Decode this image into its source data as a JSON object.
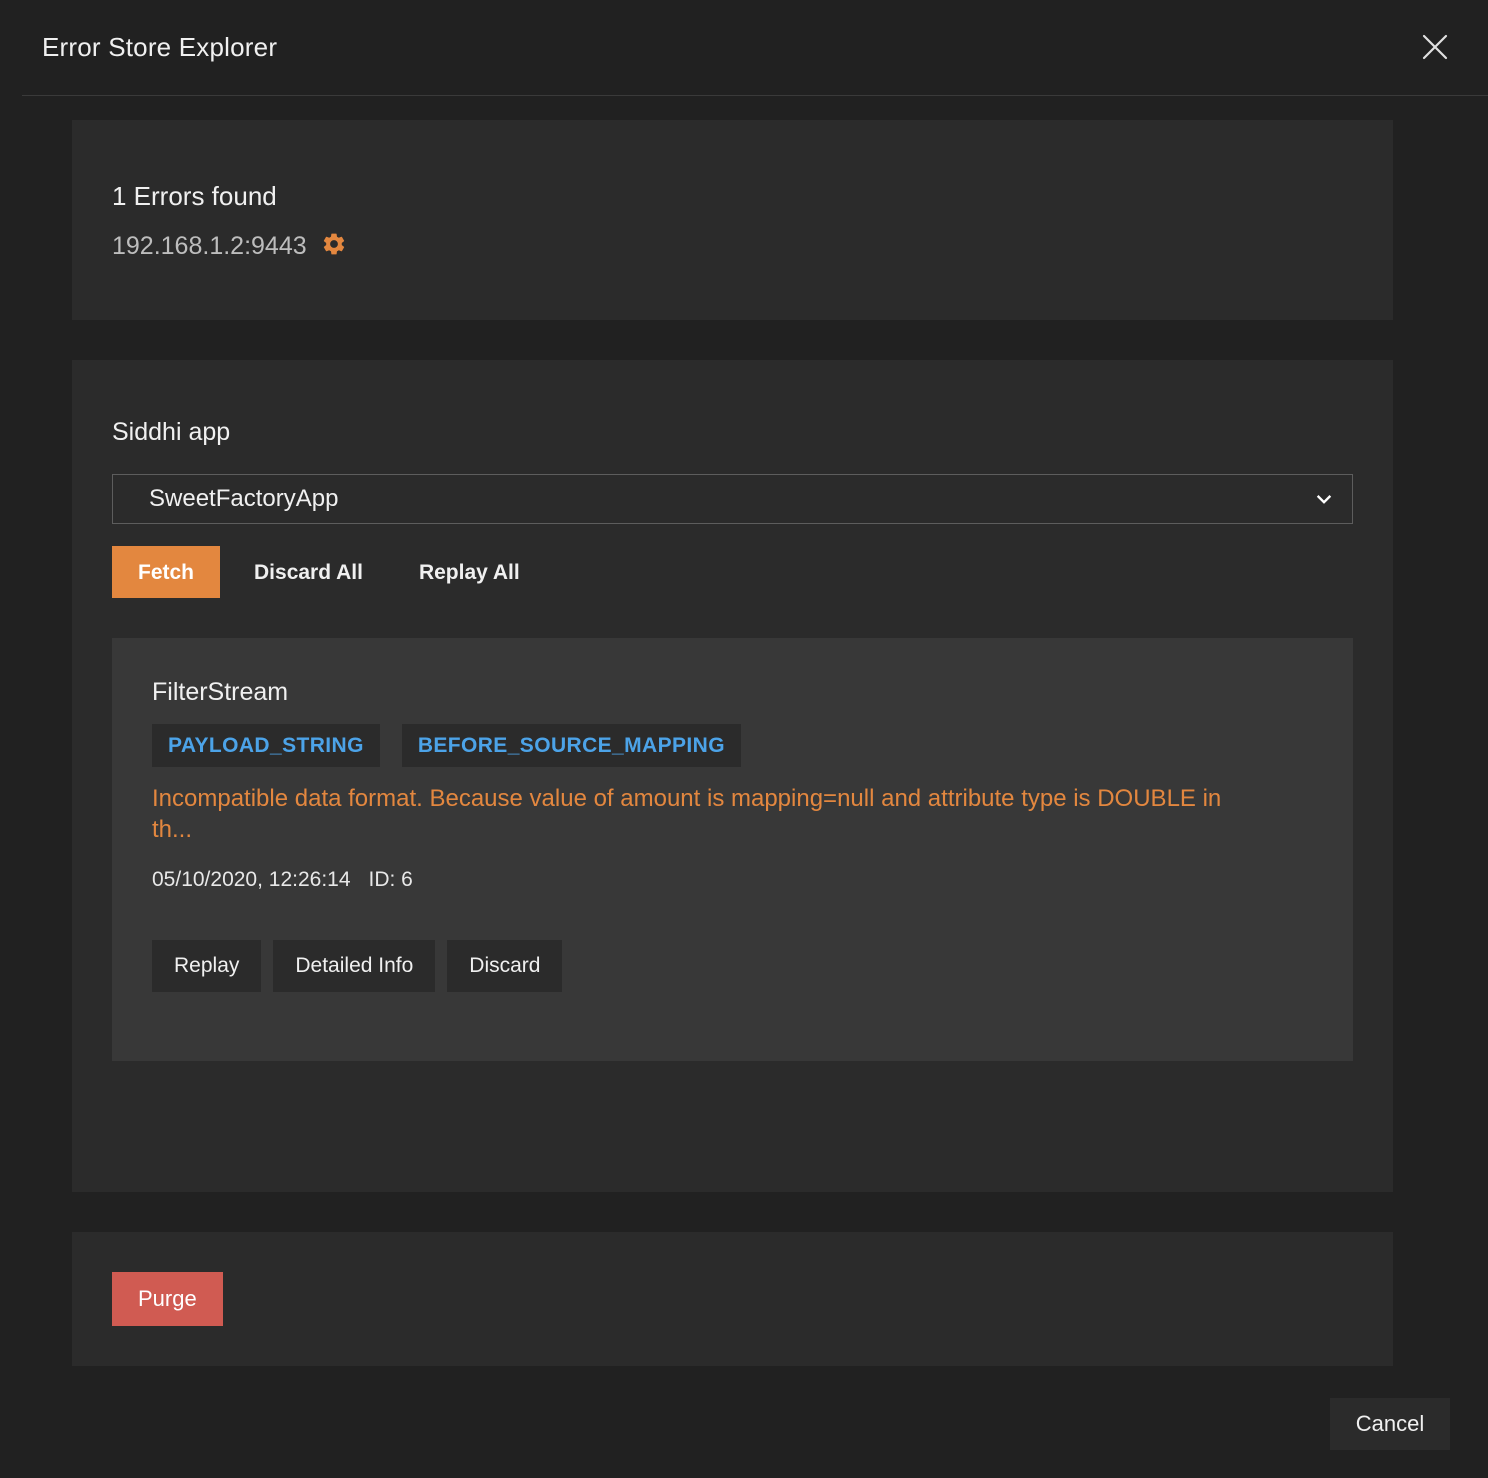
{
  "modal": {
    "title": "Error Store Explorer",
    "close_icon": "close-icon"
  },
  "summary": {
    "errors_found": "1 Errors found",
    "host": "192.168.1.2:9443",
    "settings_icon": "gear-icon"
  },
  "form": {
    "label": "Siddhi app",
    "selected_app": "SweetFactoryApp",
    "dropdown_icon": "chevron-down-icon",
    "actions": {
      "fetch": "Fetch",
      "discard_all": "Discard All",
      "replay_all": "Replay All"
    }
  },
  "error_card": {
    "stream_name": "FilterStream",
    "chips": [
      "PAYLOAD_STRING",
      "BEFORE_SOURCE_MAPPING"
    ],
    "message": "Incompatible data format. Because value of amount is mapping=null and attribute type is DOUBLE in th...",
    "timestamp": "05/10/2020, 12:26:14",
    "id_label": "ID: 6",
    "actions": {
      "replay": "Replay",
      "detailed_info": "Detailed Info",
      "discard": "Discard"
    }
  },
  "purge": {
    "label": "Purge"
  },
  "footer": {
    "cancel": "Cancel"
  },
  "colors": {
    "modal_bg": "#212121",
    "panel_bg": "#2b2b2b",
    "card_bg": "#383838",
    "accent_orange": "#e3873f",
    "chip_blue": "#4ca3e8",
    "purge_red": "#d05b52",
    "text_primary": "#f0f0f0",
    "text_muted": "#bdbdbd",
    "border": "#5d5d5d"
  }
}
